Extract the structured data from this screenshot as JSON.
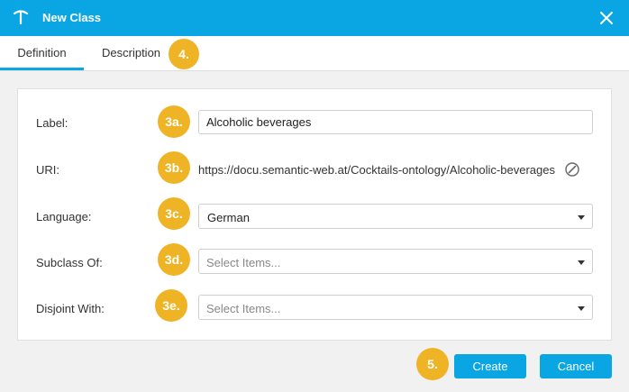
{
  "dialog": {
    "title": "New Class",
    "app_icon": "pickaxe-logo-icon",
    "close_icon": "close-icon"
  },
  "tabs": [
    {
      "label": "Definition",
      "active": true
    },
    {
      "label": "Description",
      "active": false
    }
  ],
  "annotations": {
    "tab_description": "4.",
    "label": "3a.",
    "uri": "3b.",
    "language": "3c.",
    "subclass_of": "3d.",
    "disjoint_with": "3e.",
    "create": "5."
  },
  "form": {
    "label": {
      "label": "Label:",
      "value": "Alcoholic beverages"
    },
    "uri": {
      "label": "URI:",
      "value": "https://docu.semantic-web.at/Cocktails-ontology/Alcoholic-beverages",
      "edit_icon": "edit-circle-icon"
    },
    "language": {
      "label": "Language:",
      "value": "German"
    },
    "subclass_of": {
      "label": "Subclass Of:",
      "placeholder": "Select Items..."
    },
    "disjoint_with": {
      "label": "Disjoint With:",
      "placeholder": "Select Items..."
    }
  },
  "buttons": {
    "create": "Create",
    "cancel": "Cancel"
  },
  "colors": {
    "accent": "#0aa6e4",
    "annotation_badge": "#efb425",
    "background": "#f1f1f1"
  }
}
